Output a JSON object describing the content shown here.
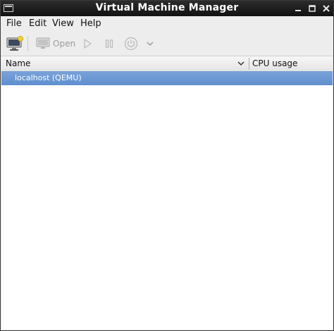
{
  "window": {
    "title": "Virtual Machine Manager",
    "icons": {
      "app": "vm-window-icon",
      "minimize": "minimize-icon",
      "maximize": "maximize-icon",
      "close": "close-icon"
    }
  },
  "menubar": {
    "items": [
      {
        "label": "File"
      },
      {
        "label": "Edit"
      },
      {
        "label": "View"
      },
      {
        "label": "Help"
      }
    ]
  },
  "toolbar": {
    "new_vm_icon": "new-vm-icon",
    "open_label": "Open",
    "run_icon": "play-icon",
    "pause_icon": "pause-icon",
    "shutdown_icon": "power-icon",
    "menu_icon": "chevron-down-icon"
  },
  "list": {
    "columns": [
      {
        "label": "Name"
      },
      {
        "label": "CPU usage"
      }
    ],
    "rows": [
      {
        "label": "localhost (QEMU)",
        "selected": true
      }
    ]
  },
  "colors": {
    "titlebar": "#1e1e1e",
    "selection": "#6b97d3",
    "disabled_text": "#9a9a9a"
  }
}
